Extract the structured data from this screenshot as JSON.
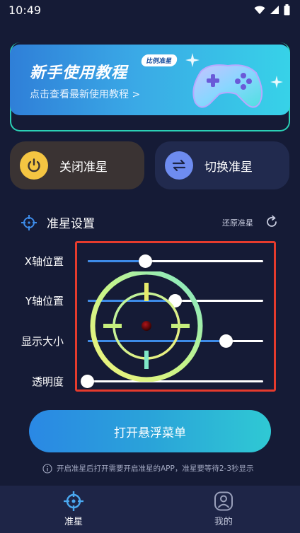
{
  "status_bar": {
    "time": "10:49"
  },
  "banner": {
    "title": "新手使用教程",
    "badge": "比例准星",
    "subtitle": "点击查看最新使用教程 >"
  },
  "actions": {
    "toggle_label": "关闭准星",
    "switch_label": "切换准星"
  },
  "settings": {
    "title": "准星设置",
    "reset_label": "还原准星",
    "sliders": [
      {
        "label": "X轴位置",
        "value": 0.33
      },
      {
        "label": "Y轴位置",
        "value": 0.5
      },
      {
        "label": "显示大小",
        "value": 0.79
      },
      {
        "label": "透明度",
        "value": 0.0
      }
    ]
  },
  "open_menu_label": "打开悬浮菜单",
  "notice": "开启准星后打开需要开启准星的APP，准星要等待2-3秒显示",
  "nav": {
    "items": [
      {
        "label": "准星",
        "active": true
      },
      {
        "label": "我的",
        "active": false
      }
    ]
  },
  "colors": {
    "background": "#151b36",
    "accent_blue": "#3d8be8",
    "active_nav": "#4aa8f0",
    "highlight_red": "#e53b2d",
    "power_yellow": "#f4c542"
  }
}
